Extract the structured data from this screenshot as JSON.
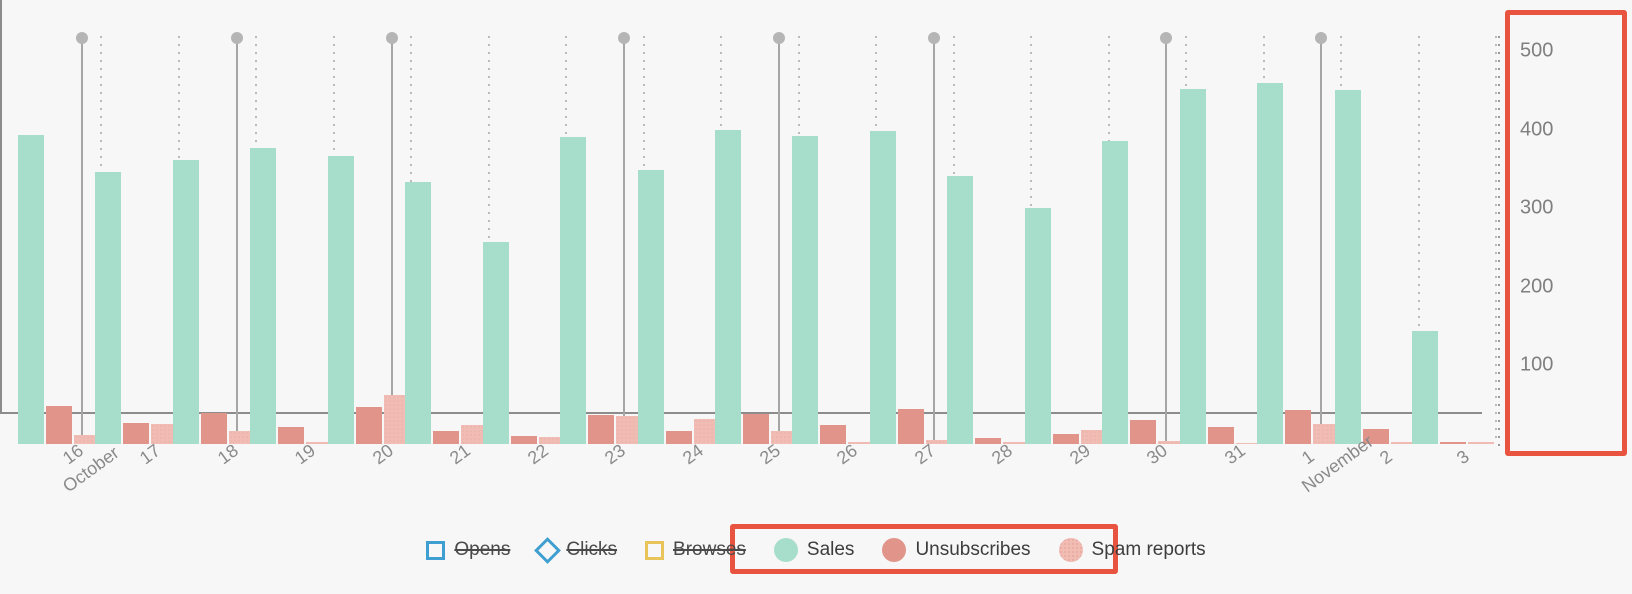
{
  "chart_data": {
    "type": "bar",
    "title": "",
    "xlabel": "",
    "ylabel": "",
    "ylim": [
      0,
      520
    ],
    "y_ticks": [
      100,
      200,
      300,
      400,
      500
    ],
    "grid": "dotted-vertical",
    "legend_position": "bottom-center",
    "categories": [
      "16",
      "17",
      "18",
      "19",
      "20",
      "21",
      "22",
      "23",
      "24",
      "25",
      "26",
      "27",
      "28",
      "29",
      "30",
      "31",
      "1",
      "2",
      "3"
    ],
    "category_months": [
      "October",
      "",
      "",
      "",
      "",
      "",
      "",
      "",
      "",
      "",
      "",
      "",
      "",
      "",
      "",
      "",
      "November",
      "",
      ""
    ],
    "series": [
      {
        "name": "Sales",
        "color": "#a7ddcb",
        "visible": true,
        "values": [
          393,
          346,
          361,
          376,
          367,
          333,
          257,
          390,
          348,
          400,
          392,
          398,
          341,
          300,
          386,
          452,
          459,
          450,
          144
        ]
      },
      {
        "name": "Unsubscribes",
        "color": "#e0948a",
        "visible": true,
        "values": [
          48,
          27,
          40,
          22,
          47,
          16,
          10,
          37,
          16,
          38,
          24,
          44,
          8,
          13,
          30,
          22,
          43,
          19,
          3
        ]
      },
      {
        "name": "Spam reports",
        "color": "#f0bcb4",
        "visible": true,
        "values": [
          11,
          25,
          17,
          2,
          62,
          24,
          9,
          36,
          32,
          17,
          3,
          5,
          2,
          18,
          4,
          1,
          25,
          2,
          2
        ]
      },
      {
        "name": "Opens",
        "color": "#3f9fd0",
        "visible": false,
        "values": []
      },
      {
        "name": "Clicks",
        "color": "#3f9fd0",
        "visible": false,
        "values": []
      },
      {
        "name": "Browses",
        "color": "#e8c45a",
        "visible": false,
        "values": []
      }
    ],
    "markers": {
      "name": "campaign-markers",
      "color": "#b5b5b5",
      "at_categories": [
        "16",
        "18",
        "20",
        "23",
        "25",
        "27",
        "30",
        "1"
      ]
    },
    "annotations": {
      "highlight_color": "#e8543f",
      "boxes": [
        {
          "name": "y-axis-highlight",
          "target": "y-axis"
        },
        {
          "name": "legend-highlight",
          "target": "active-legend-items"
        }
      ]
    }
  },
  "legend": {
    "items": [
      {
        "label": "Opens",
        "icon": "square-outline-icon",
        "color": "#3f9fd0",
        "disabled": true
      },
      {
        "label": "Clicks",
        "icon": "diamond-outline-icon",
        "color": "#3f9fd0",
        "disabled": true
      },
      {
        "label": "Browses",
        "icon": "square-outline-icon",
        "color": "#e8c45a",
        "disabled": true
      },
      {
        "label": "Sales",
        "icon": "circle-icon",
        "color": "#a7ddcb",
        "disabled": false
      },
      {
        "label": "Unsubscribes",
        "icon": "circle-icon",
        "color": "#e0948a",
        "disabled": false
      },
      {
        "label": "Spam reports",
        "icon": "circle-dotted-icon",
        "color": "#f0bcb4",
        "disabled": false
      }
    ]
  },
  "y_axis": {
    "labels": [
      "500",
      "400",
      "300",
      "200",
      "100"
    ]
  },
  "x_axis": {
    "labels": [
      "16",
      "17",
      "18",
      "19",
      "20",
      "21",
      "22",
      "23",
      "24",
      "25",
      "26",
      "27",
      "28",
      "29",
      "30",
      "31",
      "1",
      "2",
      "3"
    ],
    "month_labels": [
      {
        "index": 0,
        "text": "October"
      },
      {
        "index": 16,
        "text": "November"
      }
    ]
  }
}
